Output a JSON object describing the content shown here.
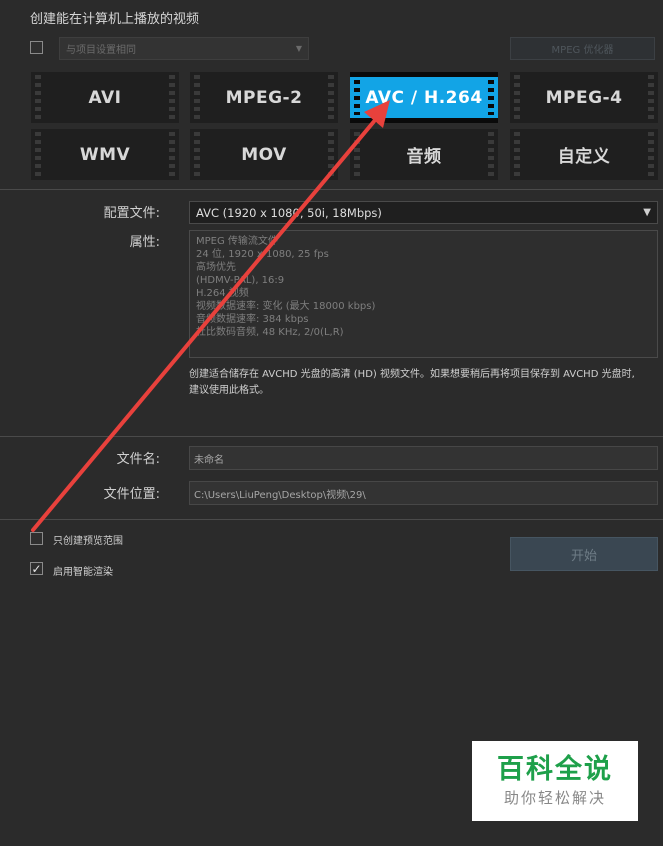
{
  "header": {
    "title": "创建能在计算机上播放的视频",
    "same_as_project_label": "与项目设置相同",
    "mpeg_optimizer_label": "MPEG 优化器"
  },
  "formats": [
    {
      "label": "AVI",
      "selected": false
    },
    {
      "label": "MPEG-2",
      "selected": false
    },
    {
      "label": "AVC / H.264",
      "selected": true
    },
    {
      "label": "MPEG-4",
      "selected": false
    },
    {
      "label": "WMV",
      "selected": false
    },
    {
      "label": "MOV",
      "selected": false
    },
    {
      "label": "音频",
      "selected": false
    },
    {
      "label": "自定义",
      "selected": false
    }
  ],
  "profile": {
    "label": "配置文件:",
    "value": "AVC (1920 x 1080, 50i, 18Mbps)"
  },
  "properties": {
    "label": "属性:",
    "lines": [
      "MPEG 传输流文件",
      "24 位, 1920 x 1080, 25 fps",
      "高场优先",
      "(HDMV-PAL), 16:9",
      "H.264 视频",
      "视频数据速率: 变化 (最大 18000 kbps)",
      "音频数据速率: 384 kbps",
      "杜比数码音频, 48 KHz, 2/0(L,R)"
    ]
  },
  "description": {
    "line1": "创建适合储存在 AVCHD 光盘的高清 (HD) 视频文件。如果想要稍后再将项目保存到 AVCHD 光盘时,",
    "line2": "建议使用此格式。"
  },
  "file_name": {
    "label": "文件名:",
    "value": "未命名"
  },
  "file_location": {
    "label": "文件位置:",
    "value": "C:\\Users\\LiuPeng\\Desktop\\视频\\29\\"
  },
  "options": {
    "preview_only_label": "只创建预览范围",
    "preview_only_checked": false,
    "smart_render_label": "启用智能渲染",
    "smart_render_checked": true
  },
  "start_button": {
    "label": "开始"
  },
  "watermark": {
    "main": "百科全说",
    "sub": "助你轻松解决"
  },
  "colors": {
    "selected_tile": "#12a4e6",
    "annotation_arrow": "#e8413c",
    "watermark_green": "#1ea04a"
  }
}
